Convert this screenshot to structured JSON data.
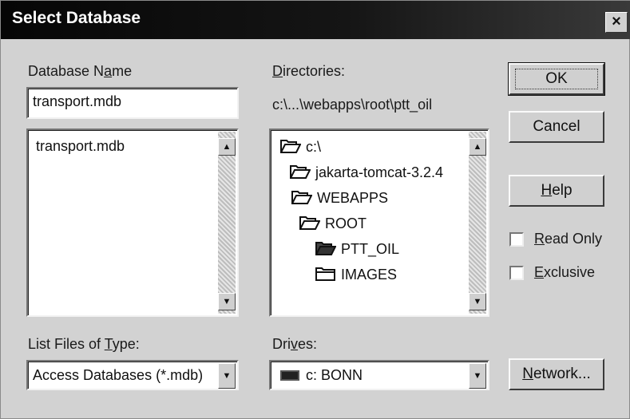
{
  "dialog": {
    "title": "Select Database",
    "close_label": "×"
  },
  "database_name": {
    "label_pre": "Database N",
    "label_key": "a",
    "label_post": "me",
    "value": "transport.mdb",
    "files": [
      "transport.mdb"
    ]
  },
  "directories": {
    "label_key": "D",
    "label_post": "irectories:",
    "current_path": "c:\\...\\webapps\\root\\ptt_oil",
    "items": [
      {
        "name": "c:\\",
        "state": "open"
      },
      {
        "name": "jakarta-tomcat-3.2.4",
        "state": "open"
      },
      {
        "name": "WEBAPPS",
        "state": "open"
      },
      {
        "name": "ROOT",
        "state": "open"
      },
      {
        "name": "PTT_OIL",
        "state": "current"
      },
      {
        "name": "IMAGES",
        "state": "closed"
      }
    ]
  },
  "file_type": {
    "label_pre": "List Files of ",
    "label_key": "T",
    "label_post": "ype:",
    "value": "Access Databases (*.mdb)"
  },
  "drives": {
    "label_pre": "Dri",
    "label_key": "v",
    "label_post": "es:",
    "value": "c: BONN"
  },
  "buttons": {
    "ok": "OK",
    "cancel": "Cancel",
    "help_key": "H",
    "help_post": "elp",
    "network_key": "N",
    "network_post": "etwork..."
  },
  "options": {
    "read_only_key": "R",
    "read_only_post": "ead Only",
    "read_only_checked": false,
    "exclusive_key": "E",
    "exclusive_post": "xclusive",
    "exclusive_checked": false
  },
  "icons": {
    "folder": "folder-icon",
    "open_folder": "folder-open-icon",
    "drive": "hard-drive-icon"
  }
}
